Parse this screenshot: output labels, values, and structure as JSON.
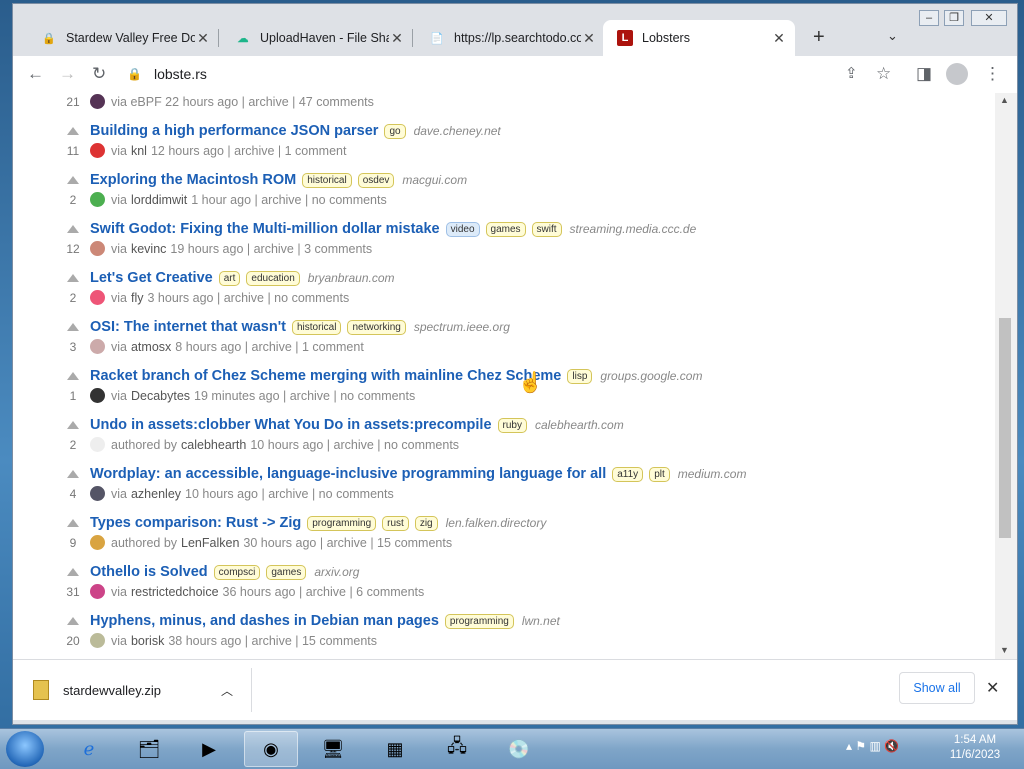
{
  "browser": {
    "tabs": [
      {
        "title": "Stardew Valley Free Dow",
        "favicon": "lock-purple-icon",
        "active": false
      },
      {
        "title": "UploadHaven - File Shar",
        "favicon": "upload-cloud-icon",
        "active": false
      },
      {
        "title": "https://lp.searchtodo.co",
        "favicon": "document-icon",
        "active": false
      },
      {
        "title": "Lobsters",
        "favicon": "lobsters-L-icon",
        "active": true
      }
    ],
    "address": "lobste.rs"
  },
  "partial_top": {
    "meta": "via eBPF 22 hours ago | archive | 47 comments",
    "score": "21"
  },
  "stories": [
    {
      "title": "Building a high performance JSON parser",
      "tags": [
        "go"
      ],
      "domain": "dave.cheney.net",
      "score": "11",
      "prefix": "via",
      "user": "knl",
      "meta": "12 hours ago | archive | 1 comment",
      "avatar_color": "#d33"
    },
    {
      "title": "Exploring the Macintosh ROM",
      "tags": [
        "historical",
        "osdev"
      ],
      "domain": "macgui.com",
      "score": "2",
      "prefix": "via",
      "user": "lorddimwit",
      "meta": "1 hour ago | archive | no comments",
      "avatar_color": "#4caf50"
    },
    {
      "title": "Swift Godot: Fixing the Multi-million dollar mistake",
      "tags": [
        "video",
        "games",
        "swift"
      ],
      "domain": "streaming.media.ccc.de",
      "score": "12",
      "prefix": "via",
      "user": "kevinc",
      "meta": "19 hours ago | archive | 3 comments",
      "avatar_color": "#c87"
    },
    {
      "title": "Let's Get Creative",
      "tags": [
        "art",
        "education"
      ],
      "domain": "bryanbraun.com",
      "score": "2",
      "prefix": "via",
      "user": "fly",
      "meta": "3 hours ago | archive | no comments",
      "avatar_color": "#e57"
    },
    {
      "title": "OSI: The internet that wasn't",
      "tags": [
        "historical",
        "networking"
      ],
      "domain": "spectrum.ieee.org",
      "score": "3",
      "prefix": "via",
      "user": "atmosx",
      "meta": "8 hours ago | archive | 1 comment",
      "avatar_color": "#caa"
    },
    {
      "title": "Racket branch of Chez Scheme merging with mainline Chez Scheme",
      "tags": [
        "lisp"
      ],
      "domain": "groups.google.com",
      "score": "1",
      "prefix": "via",
      "user": "Decabytes",
      "meta": "19 minutes ago | archive | no comments",
      "avatar_color": "#333"
    },
    {
      "title": "Undo in assets:clobber What You Do in assets:precompile",
      "tags": [
        "ruby"
      ],
      "domain": "calebhearth.com",
      "score": "2",
      "prefix": "authored by",
      "user": "calebhearth",
      "meta": "10 hours ago | archive | no comments",
      "avatar_color": "#eee"
    },
    {
      "title": "Wordplay: an accessible, language-inclusive programming language for all",
      "tags": [
        "a11y",
        "plt"
      ],
      "domain": "medium.com",
      "score": "4",
      "prefix": "via",
      "user": "azhenley",
      "meta": "10 hours ago | archive | no comments",
      "avatar_color": "#556"
    },
    {
      "title": "Types comparison: Rust -> Zig",
      "tags": [
        "programming",
        "rust",
        "zig"
      ],
      "domain": "len.falken.directory",
      "score": "9",
      "prefix": "authored by",
      "user": "LenFalken",
      "meta": "30 hours ago | archive | 15 comments",
      "avatar_color": "#d9a441"
    },
    {
      "title": "Othello is Solved",
      "tags": [
        "compsci",
        "games"
      ],
      "domain": "arxiv.org",
      "score": "31",
      "prefix": "via",
      "user": "restrictedchoice",
      "meta": "36 hours ago | archive | 6 comments",
      "avatar_color": "#c48"
    },
    {
      "title": "Hyphens, minus, and dashes in Debian man pages",
      "tags": [
        "programming"
      ],
      "domain": "lwn.net",
      "score": "20",
      "prefix": "via",
      "user": "borisk",
      "meta": "38 hours ago | archive | 15 comments",
      "avatar_color": "#bb9"
    }
  ],
  "downloads": {
    "file": "stardewvalley.zip",
    "show_all": "Show all"
  },
  "clock": {
    "time": "1:54 AM",
    "date": "11/6/2023"
  }
}
